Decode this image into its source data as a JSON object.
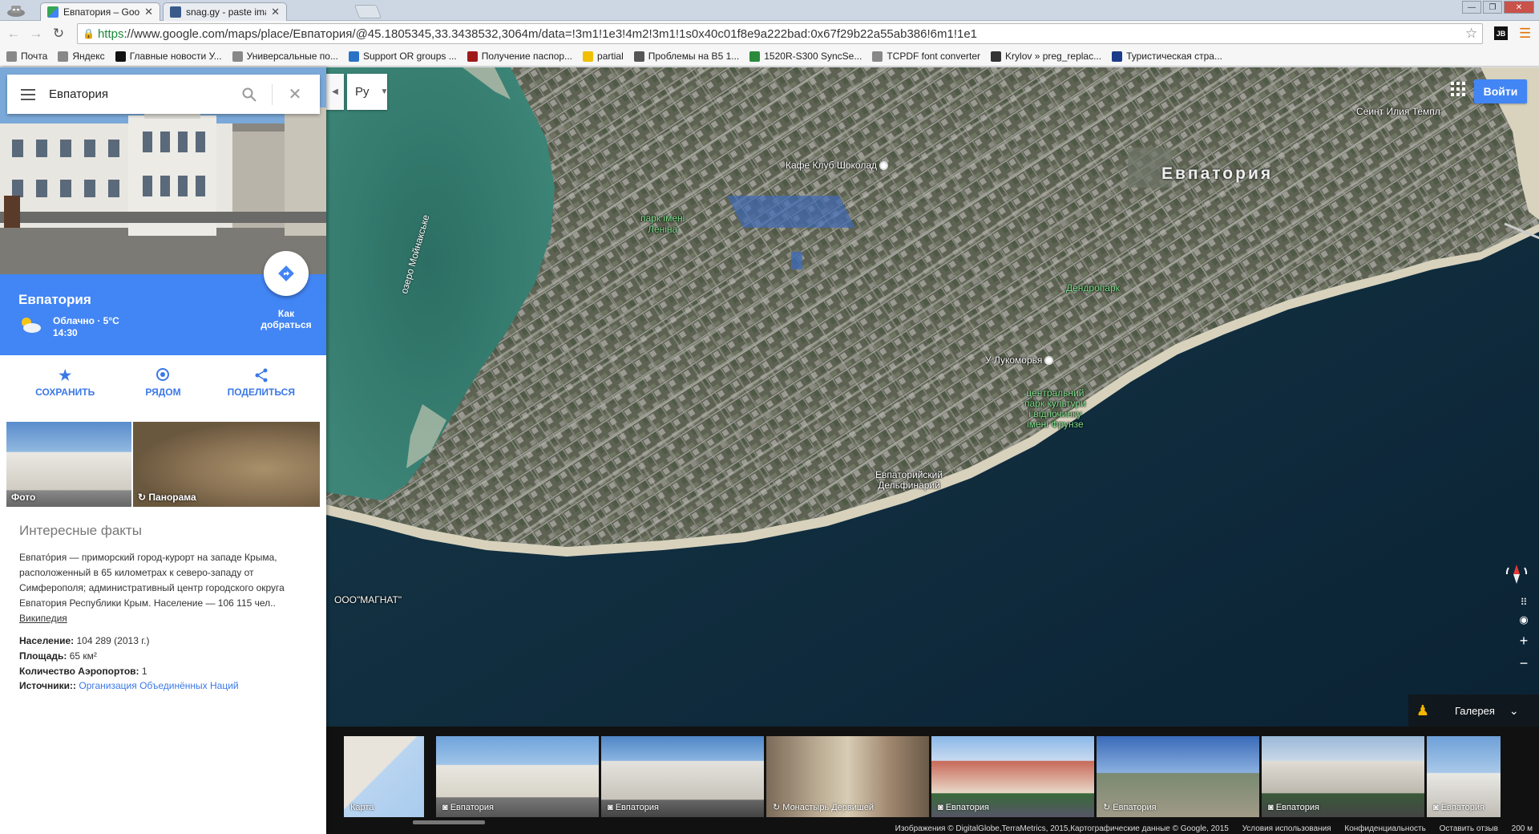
{
  "browser": {
    "tabs": [
      {
        "title": "Евпатория – Google Карт",
        "active": true
      },
      {
        "title": "snag.gy - paste images!",
        "active": false
      }
    ],
    "url_https": "https",
    "url_rest": "://www.google.com/maps/place/Евпатория/@45.1805345,33.3438532,3064m/data=!3m1!1e3!4m2!3m1!1s0x40c01f8e9a222bad:0x67f29b22a55ab386!6m1!1e1",
    "jb_label": "JB",
    "bookmarks": [
      {
        "label": "Почта",
        "icon": "page-icon",
        "color": "#888888"
      },
      {
        "label": "Яндекс",
        "icon": "page-icon",
        "color": "#888888"
      },
      {
        "label": "Главные новости У...",
        "icon": "news-icon",
        "color": "#111111"
      },
      {
        "label": "Универсальные по...",
        "icon": "page-icon",
        "color": "#888888"
      },
      {
        "label": "Support OR groups ...",
        "icon": "support-icon",
        "color": "#2a72c8"
      },
      {
        "label": "Получение паспор...",
        "icon": "passport-icon",
        "color": "#a01a1a"
      },
      {
        "label": "partial",
        "icon": "partial-icon",
        "color": "#f0c000"
      },
      {
        "label": "Проблемы на B5 1...",
        "icon": "globe-icon",
        "color": "#555555"
      },
      {
        "label": "1520R-S300 SyncSe...",
        "icon": "sync-icon",
        "color": "#2a8a3a"
      },
      {
        "label": "TCPDF font converter",
        "icon": "page-icon",
        "color": "#888888"
      },
      {
        "label": "Krylov » preg_replac...",
        "icon": "k-icon",
        "color": "#333333"
      },
      {
        "label": "Туристическая стра...",
        "icon": "tourist-icon",
        "color": "#1a3a8a"
      }
    ]
  },
  "search": {
    "value": "Евпатория"
  },
  "place": {
    "name": "Евпатория",
    "weather_line1": "Облачно · 5°C",
    "weather_line2": "14:30",
    "directions_line1": "Как",
    "directions_line2": "добраться"
  },
  "actions": [
    {
      "label": "СОХРАНИТЬ",
      "icon": "star-icon"
    },
    {
      "label": "РЯДОМ",
      "icon": "nearby-icon"
    },
    {
      "label": "ПОДЕЛИТЬСЯ",
      "icon": "share-icon"
    }
  ],
  "photos": [
    {
      "label": "Фото"
    },
    {
      "label": "Панорама"
    }
  ],
  "facts": {
    "heading": "Интересные факты",
    "text": "Евпато́рия — приморский город-курорт на западе Крыма, расположенный в 65 километрах к северо-западу от Симферополя; административный центр городского округа Евпатория Республики Крым. Население — 106 115 чел..",
    "link": "Википедия",
    "population_label": "Население:",
    "population_value": "104 289 (2013 г.)",
    "area_label": "Площадь:",
    "area_value": "65 км²",
    "airports_label": "Количество Аэропортов:",
    "airports_value": "1",
    "sources_label": "Источники::",
    "sources_value": "Организация Объединённых Наций"
  },
  "map": {
    "lang": "Ру",
    "signin": "Войти",
    "city_label": "Евпатория",
    "lake_label": "озеро Мойнакське",
    "labels": {
      "cafe": "Кафе Клуб Шоколад",
      "park_lenin1": "парк імені",
      "park_lenin2": "Леніна",
      "dendropark": "Дендропарк",
      "lukomorye": "У Лукоморья",
      "cpark1": "центральний",
      "cpark2": "парк культури",
      "cpark3": "і відпочинку",
      "cpark4": "імені Фрунзе",
      "dolphin1": "Евпаторийский",
      "dolphin2": "Дельфинарий",
      "magnat": "ООО\"МАГНАТ\"",
      "temple": "Сеинт Илия Темпл"
    },
    "gallery": "Галерея",
    "thumbs": [
      {
        "label": "Карта"
      },
      {
        "label": "Евпатория"
      },
      {
        "label": "Евпатория"
      },
      {
        "label": "Монастырь Дервишей"
      },
      {
        "label": "Евпатория"
      },
      {
        "label": "Евпатория"
      },
      {
        "label": "Евпатория"
      },
      {
        "label": "Евпатория"
      }
    ],
    "attribution": "Изображения © DigitalGlobe,TerraMetrics, 2015,Картографические данные © Google, 2015",
    "terms": "Условия использования",
    "privacy": "Конфиденциальность",
    "feedback": "Оставить отзыв",
    "scale": "200 м"
  },
  "colors": {
    "accent": "#4285f4",
    "sea": "#0f2a3e",
    "lagoon": "#2f6e64",
    "land": "#6b6d5e"
  }
}
